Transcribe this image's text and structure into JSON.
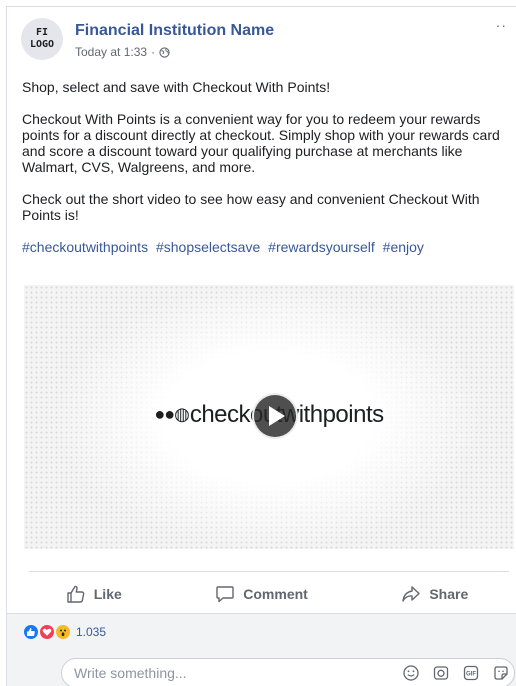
{
  "post": {
    "page_name": "Financial Institution Name",
    "logo": {
      "line1": "FI",
      "line2": "LOGO"
    },
    "timestamp": "Today at 1:33",
    "separator": "·",
    "more": "··",
    "paragraphs": [
      "Shop, select and save with Checkout With Points!",
      "Checkout With Points is a convenient way for you to redeem your rewards points for a discount directly at checkout. Simply shop with your rewards card and score a discount toward your qualifying purchase at merchants like Walmart, CVS, Walgreens, and more.",
      "Check out the short video to see how easy and convenient Checkout With Points is!"
    ],
    "hashtags": [
      "#checkoutwithpoints",
      "#shopselectsave",
      "#rewardsyourself",
      "#enjoy"
    ]
  },
  "video": {
    "brand_dots": "●●◍",
    "brand_text": "checkoutwithpoints"
  },
  "actions": {
    "like_label": "Like",
    "comment_label": "Comment",
    "share_label": "Share"
  },
  "reactions": {
    "count": "1.035",
    "types": [
      "like-icon",
      "love-icon",
      "wow-icon"
    ]
  },
  "comment": {
    "placeholder": "Write something...",
    "value": ""
  },
  "colors": {
    "link": "#385898",
    "muted": "#606770",
    "like": "#1877f2",
    "love": "#f33e58",
    "wow": "#f7b928"
  }
}
